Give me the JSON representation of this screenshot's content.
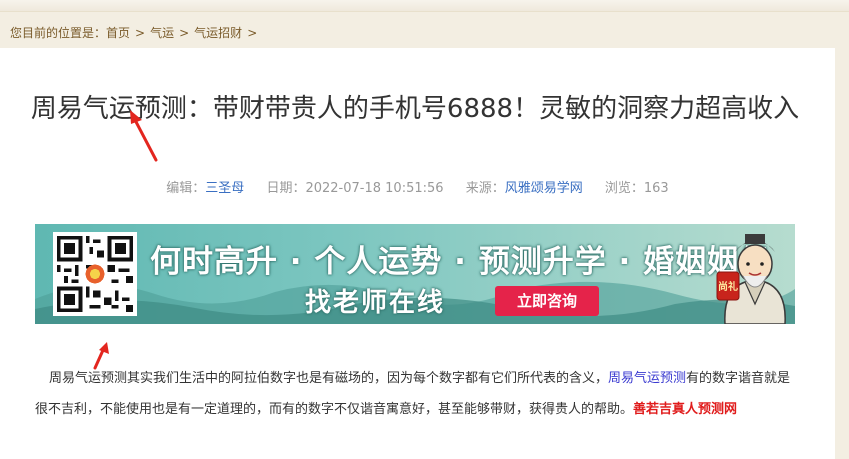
{
  "breadcrumb": {
    "prefix": "您目前的位置是：",
    "items": [
      "首页",
      "气运",
      "气运招财"
    ],
    "separator": ">"
  },
  "article": {
    "title": "周易气运预测：带财带贵人的手机号6888！灵敏的洞察力超高收入",
    "meta": {
      "editor_label": "编辑：",
      "editor": "三圣母",
      "date_label": "日期：",
      "date": "2022-07-18 10:51:56",
      "source_label": "来源：",
      "source": "风雅颂易学网",
      "views_label": "浏览：",
      "views": "163"
    },
    "body_part1": "周易气运预测其实我们生活中的阿拉伯数字也是有磁场的，因为每个数字都有它们所代表的含义，",
    "body_keyword": "周易气运预测",
    "body_part2": "有的数字谐音就是很不吉利，不能使用也是有一定道理的，而有的数字不仅谐音寓意好，甚至能够带财，获得贵人的帮助。",
    "body_red": "善若吉真人预测网"
  },
  "banner": {
    "line1": "何时高升 · 个人运势 · 预测升学 · 婚姻姻缘",
    "line2": "找老师在线",
    "button": "立即咨询",
    "badge": "尚礼"
  },
  "colors": {
    "link": "#3a6fc2",
    "accent_red": "#e01c1c",
    "button_red": "#e5234a",
    "arrow_red": "#e3261f"
  }
}
